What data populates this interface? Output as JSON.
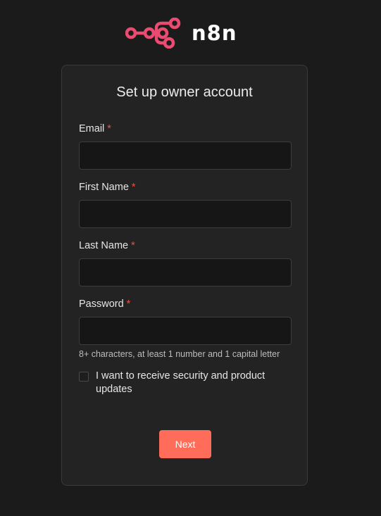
{
  "brand": {
    "name": "n8n",
    "logo_icon": "n8n-logo-icon",
    "accent_color": "#ea4b71"
  },
  "form": {
    "title": "Set up owner account",
    "required_marker": "*",
    "fields": [
      {
        "label": "Email",
        "value": "",
        "placeholder": ""
      },
      {
        "label": "First Name",
        "value": "",
        "placeholder": ""
      },
      {
        "label": "Last Name",
        "value": "",
        "placeholder": ""
      },
      {
        "label": "Password",
        "value": "",
        "placeholder": ""
      }
    ],
    "password_hint": "8+ characters, at least 1 number and 1 capital letter",
    "updates_checkbox": {
      "label": "I want to receive security and product updates",
      "checked": false
    },
    "next_label": "Next",
    "button_color": "#ff6d5a"
  }
}
